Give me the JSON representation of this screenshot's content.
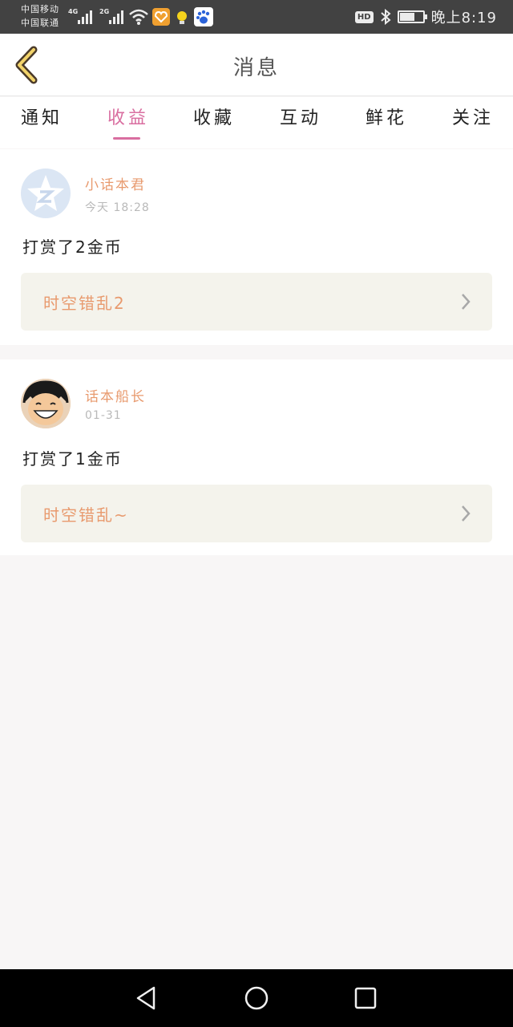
{
  "status_bar": {
    "carrier1": "中国移动",
    "carrier2": "中国联通",
    "net1": "4G",
    "net2": "2G",
    "hd": "HD",
    "time": "晚上8:19",
    "icons": [
      "wifi-icon",
      "app-heart-icon",
      "lightbulb-icon",
      "baidu-icon",
      "bluetooth-icon",
      "battery-icon"
    ]
  },
  "header": {
    "title": "消息",
    "back_icon": "chevron-left-icon",
    "accent_color": "#d96ea0"
  },
  "tabs": [
    {
      "label": "通知"
    },
    {
      "label": "收益",
      "active": true
    },
    {
      "label": "收藏"
    },
    {
      "label": "互动"
    },
    {
      "label": "鲜花"
    },
    {
      "label": "关注"
    }
  ],
  "messages": [
    {
      "user": "小话本君",
      "time": "今天  18:28",
      "text": "打赏了2金币",
      "target": "时空错乱2"
    },
    {
      "user": "话本船长",
      "time": "01-31",
      "text": "打赏了1金币",
      "target": "时空错乱~"
    }
  ],
  "system_nav": {
    "icons": [
      "back-triangle-icon",
      "home-circle-icon",
      "recents-square-icon"
    ]
  }
}
